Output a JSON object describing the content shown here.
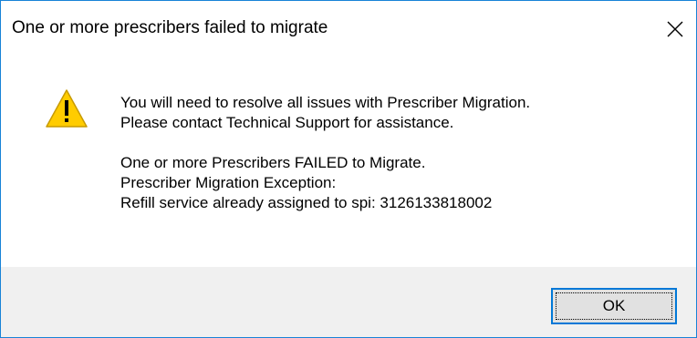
{
  "dialog": {
    "title": "One or more prescribers failed to migrate",
    "close_icon": "close-icon",
    "warning_icon": "warning-icon",
    "message_lines_1": [
      "You will need to resolve all issues with Prescriber Migration.",
      "Please contact Technical Support for assistance."
    ],
    "message_lines_2": [
      "One or more Prescribers FAILED to Migrate.",
      "Prescriber Migration Exception:",
      "Refill service already assigned to spi: 3126133818002"
    ],
    "ok_label": "OK"
  },
  "colors": {
    "window_border": "#1883d7",
    "footer_bg": "#f0f0f0",
    "button_bg": "#e1e1e1",
    "button_focus_border": "#0078d7",
    "warning_fill": "#ffcc00"
  }
}
